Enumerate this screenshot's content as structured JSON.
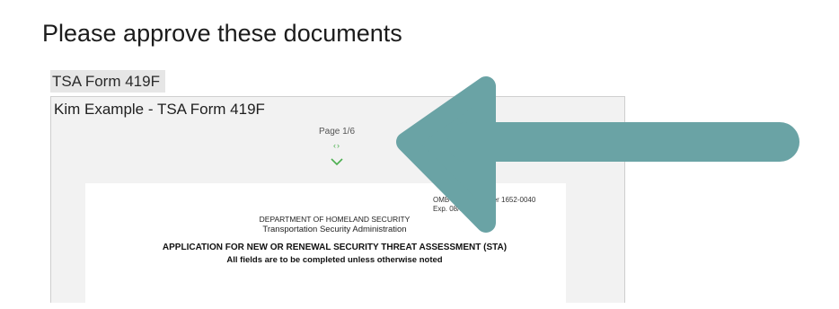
{
  "page": {
    "title": "Please approve these documents"
  },
  "document": {
    "label": "TSA Form 419F",
    "viewer_title": "Kim Example - TSA Form 419F",
    "page_indicator": "Page 1/6",
    "nav_arrows": "‹›",
    "content": {
      "omb_control": "OMB control number 1652-0040",
      "omb_exp": "Exp. 08/31/2019",
      "department": "DEPARTMENT OF HOMELAND SECURITY",
      "agency": "Transportation Security Administration",
      "application_title": "APPLICATION FOR NEW OR RENEWAL SECURITY THREAT ASSESSMENT (STA)",
      "instructions": "All fields are to be completed unless otherwise noted"
    }
  },
  "colors": {
    "arrow": "#6aa3a5",
    "nav_green": "#4caf50",
    "label_bg": "#e6e6e6",
    "viewer_bg": "#f2f2f2"
  },
  "icons": {
    "nav_arrows": "chevron-left-right-icon",
    "page_down": "chevron-down-icon",
    "overlay": "left-arrow-icon"
  }
}
